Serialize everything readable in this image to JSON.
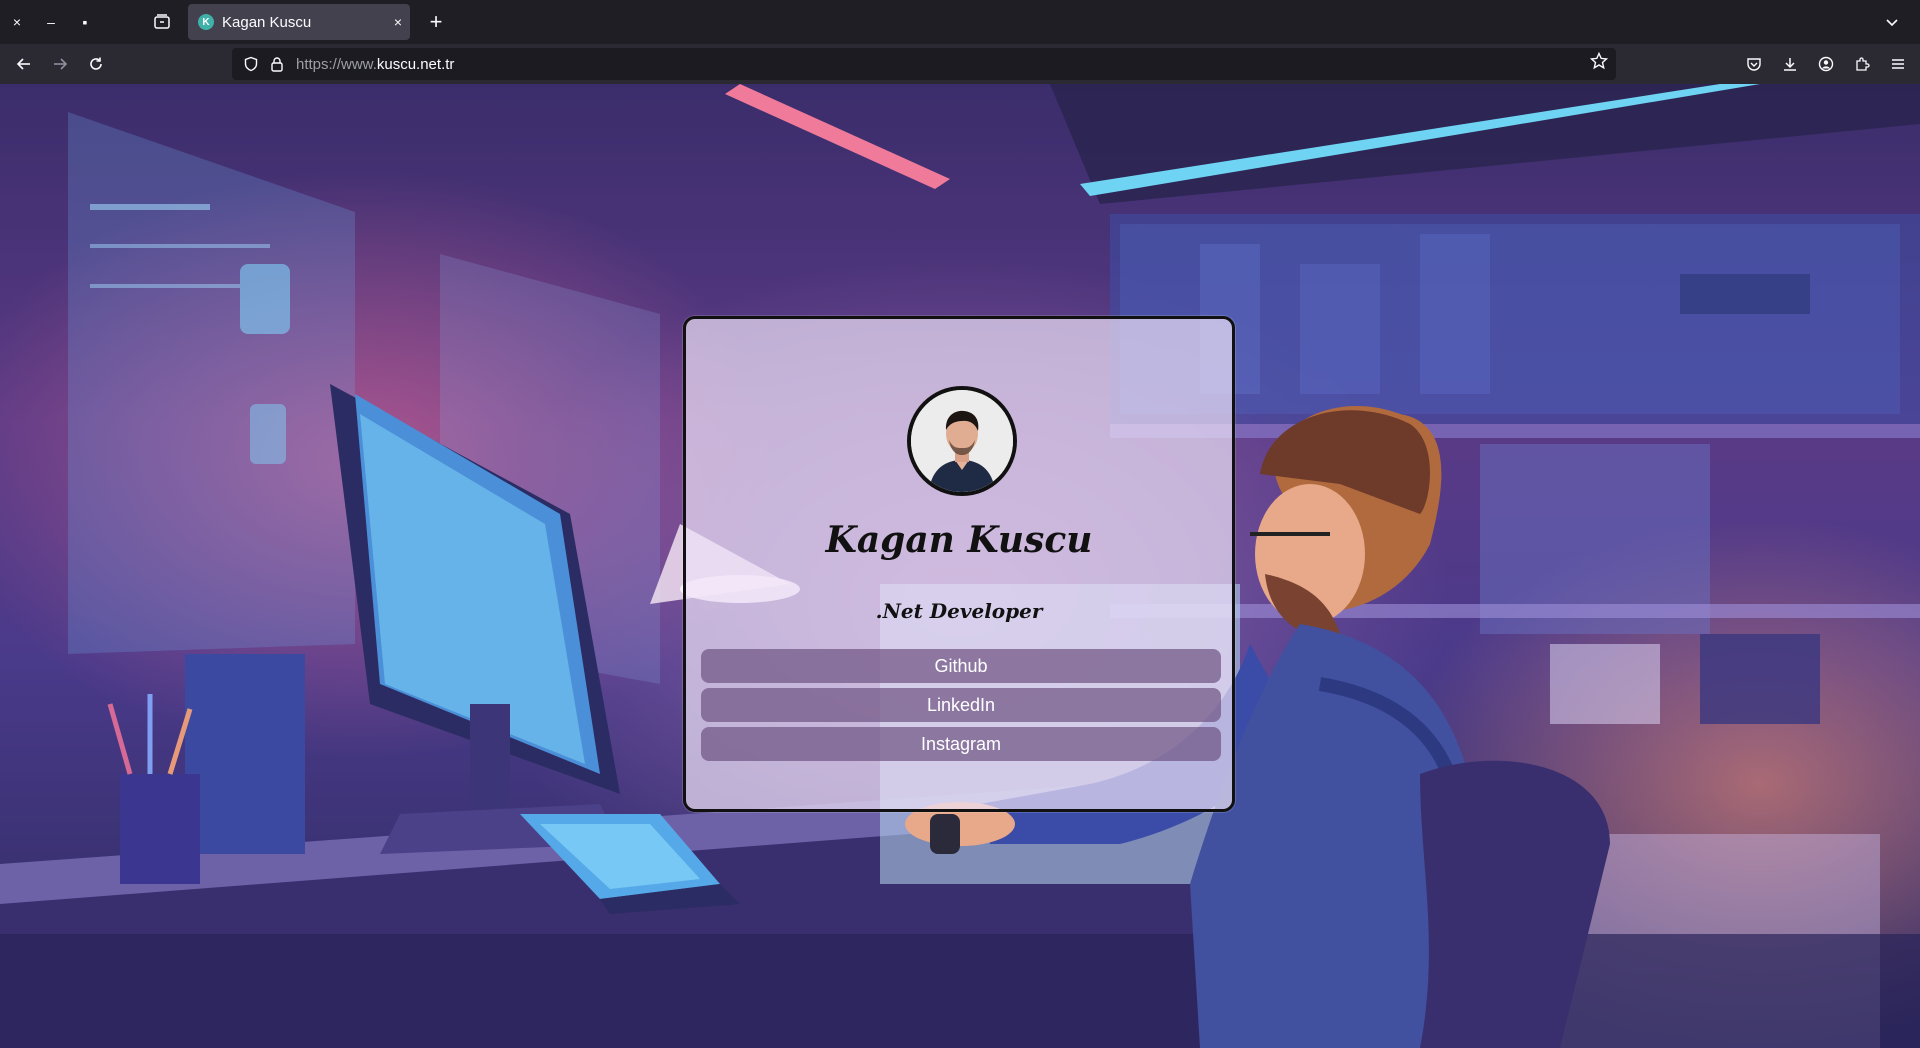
{
  "browser": {
    "tab": {
      "favicon_letter": "K",
      "title": "Kagan Kuscu",
      "close_glyph": "×"
    },
    "new_tab_glyph": "+",
    "window_controls": {
      "close": "×",
      "minimize": "–",
      "maximize": "▪"
    },
    "url": {
      "prefix": "https://www.",
      "domain": "kuscu.net.tr"
    },
    "icons": {
      "back": "arrow-left-icon",
      "forward": "arrow-right-icon",
      "reload": "reload-icon",
      "shield": "shield-icon",
      "lock": "lock-icon",
      "bookmark": "star-icon",
      "pocket": "pocket-icon",
      "downloads": "download-icon",
      "account": "account-icon",
      "extensions": "puzzle-icon",
      "menu": "hamburger-icon"
    }
  },
  "profile": {
    "name": "Kagan Kuscu",
    "role": ".Net Developer",
    "links": [
      {
        "label": "Github"
      },
      {
        "label": "LinkedIn"
      },
      {
        "label": "Instagram"
      }
    ]
  },
  "colors": {
    "chrome_dark": "#1f1e25",
    "toolbar": "#2b2a33",
    "card_bg": "#eee2f8",
    "button_bg": "#6e5282",
    "background_purple": "#4a3a8a"
  }
}
